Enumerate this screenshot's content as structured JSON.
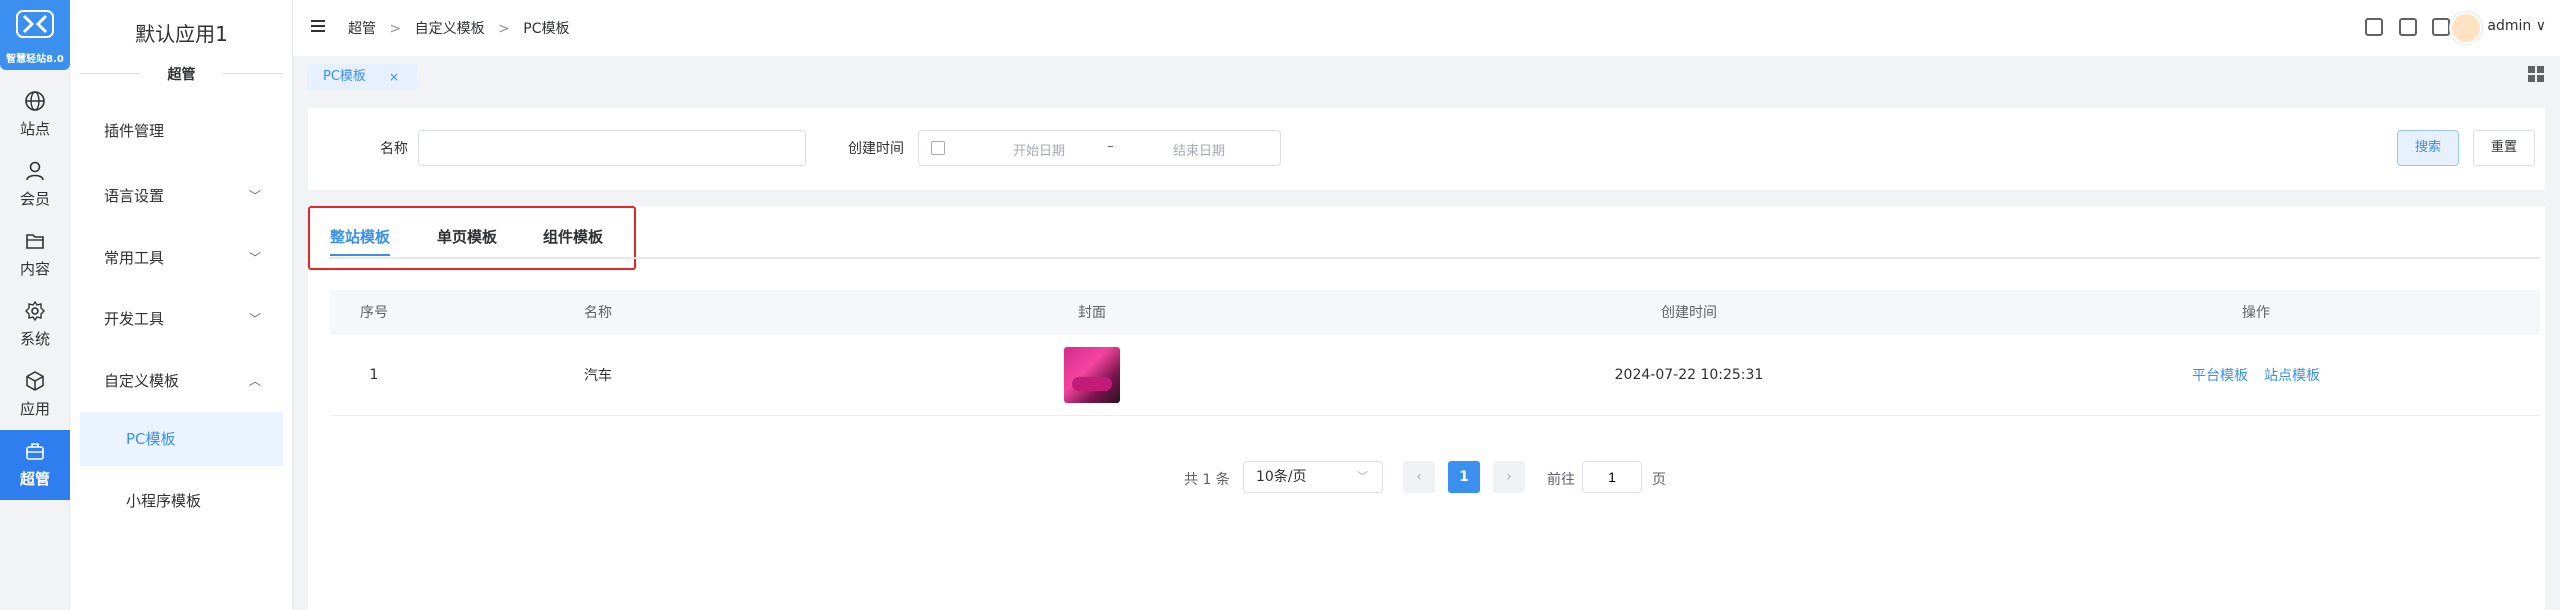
{
  "logo": {
    "text": "智慧轻站8.0"
  },
  "rail": [
    {
      "label": "站点",
      "icon": "globe-icon"
    },
    {
      "label": "会员",
      "icon": "user-icon"
    },
    {
      "label": "内容",
      "icon": "folder-icon"
    },
    {
      "label": "系统",
      "icon": "gear-icon"
    },
    {
      "label": "应用",
      "icon": "cube-icon"
    },
    {
      "label": "超管",
      "icon": "toolbox-icon",
      "active": true
    }
  ],
  "menu": {
    "app_name": "默认应用1",
    "group_title": "超管",
    "items": [
      {
        "label": "插件管理"
      },
      {
        "label": "语言设置",
        "chevron": "﹀"
      },
      {
        "label": "常用工具",
        "chevron": "﹀"
      },
      {
        "label": "开发工具",
        "chevron": "﹀"
      },
      {
        "label": "自定义模板",
        "chevron": "︿"
      },
      {
        "label": "PC模板",
        "active": true
      },
      {
        "label": "小程序模板"
      }
    ]
  },
  "breadcrumb": [
    "超管",
    "自定义模板",
    "PC模板"
  ],
  "breadcrumb_sep": ">",
  "user": {
    "name": "admin",
    "caret": "∨"
  },
  "page_tab": {
    "label": "PC模板",
    "close": "×"
  },
  "search": {
    "name_label": "名称",
    "name_value": "",
    "created_label": "创建时间",
    "start_placeholder": "开始日期",
    "range_sep": "–",
    "end_placeholder": "结束日期",
    "search_btn": "搜索",
    "reset_btn": "重置"
  },
  "template_tabs": [
    "整站模板",
    "单页模板",
    "组件模板"
  ],
  "table": {
    "columns": [
      "序号",
      "名称",
      "封面",
      "创建时间",
      "操作"
    ],
    "rows": [
      {
        "index": "1",
        "name": "汽车",
        "created": "2024-07-22 10:25:31",
        "actions": [
          "平台模板",
          "站点模板"
        ]
      }
    ]
  },
  "pagination": {
    "total": "共 1 条",
    "page_size": "10条/页",
    "prev": "‹",
    "current": "1",
    "next": "›",
    "goto_label": "前往",
    "goto_value": "1",
    "goto_unit": "页"
  },
  "colors": {
    "accent": "#3b8fef",
    "highlight_border": "#e5262a"
  }
}
